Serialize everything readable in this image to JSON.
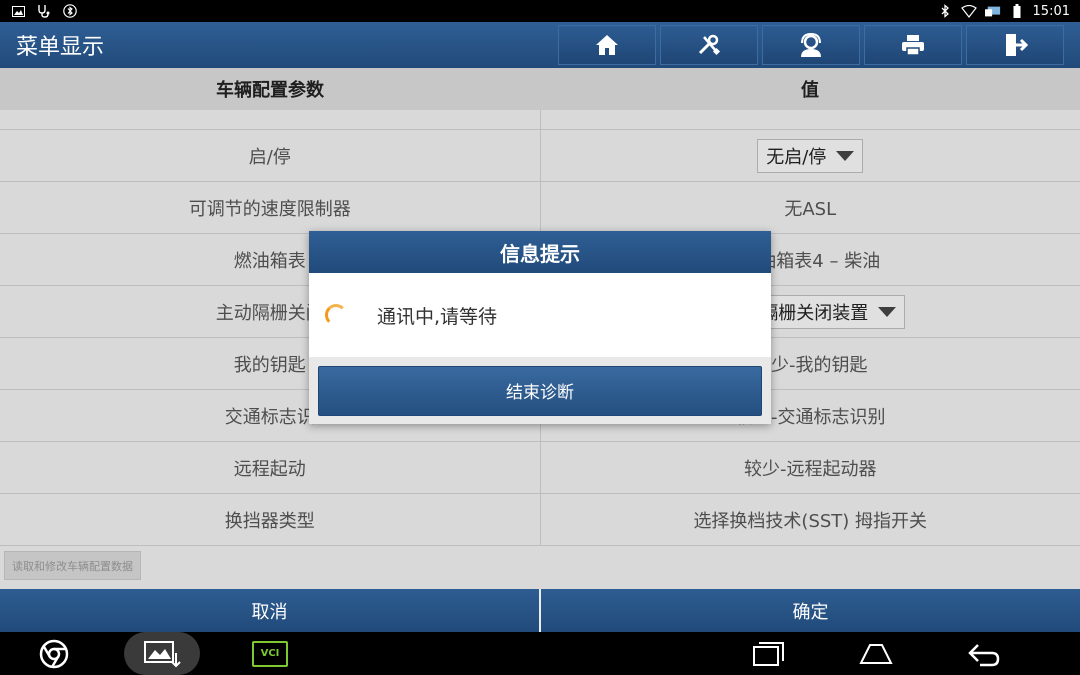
{
  "status_bar": {
    "time": "15:01"
  },
  "app": {
    "title": "菜单显示"
  },
  "toolbar": {
    "buttons": [
      {
        "icon": "home-icon"
      },
      {
        "icon": "tools-icon"
      },
      {
        "icon": "support-icon"
      },
      {
        "icon": "print-icon"
      },
      {
        "icon": "exit-icon"
      }
    ]
  },
  "table": {
    "headers": [
      "车辆配置参数",
      "值"
    ],
    "rows": [
      {
        "param": "启/停",
        "value": "无启/停",
        "dropdown": true
      },
      {
        "param": "可调节的速度限制器",
        "value": "无ASL",
        "dropdown": false
      },
      {
        "param": "燃油箱表",
        "value": "燃油箱表4 – 柴油",
        "dropdown": false
      },
      {
        "param": "主动隔栅关闭",
        "value": "主动隔栅关闭装置",
        "dropdown": true
      },
      {
        "param": "我的钥匙",
        "value": "较少-我的钥匙",
        "dropdown": false
      },
      {
        "param": "交通标志识",
        "value": "较少-交通标志识别",
        "dropdown": false
      },
      {
        "param": "远程起动",
        "value": "较少-远程起动器",
        "dropdown": false
      },
      {
        "param": "换挡器类型",
        "value": "选择换档技术(SST) 拇指开关",
        "dropdown": false
      }
    ]
  },
  "read_modify_button": "读取和修改车辆配置数据",
  "bottom": {
    "cancel": "取消",
    "confirm": "确定"
  },
  "dialog": {
    "title": "信息提示",
    "message": "通讯中,请等待",
    "button": "结束诊断"
  },
  "nav": {
    "vci_label": "VCI"
  }
}
